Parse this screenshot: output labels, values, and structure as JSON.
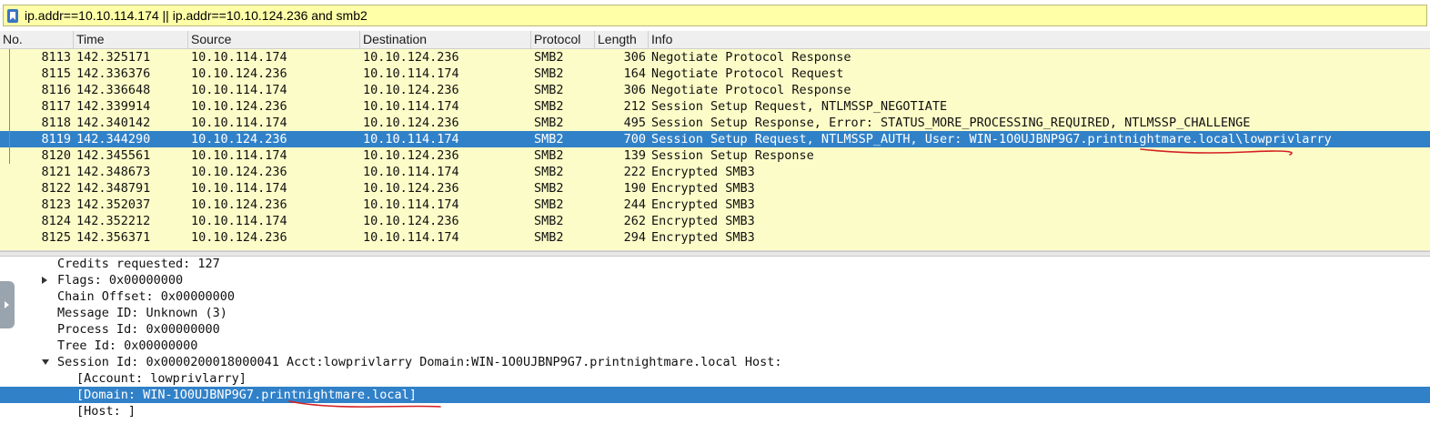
{
  "filter": {
    "value": "ip.addr==10.10.114.174 || ip.addr==10.10.124.236 and smb2",
    "icon": "bookmark-icon"
  },
  "packet_list": {
    "columns": [
      "No.",
      "Time",
      "Source",
      "Destination",
      "Protocol",
      "Length",
      "Info"
    ],
    "rows": [
      {
        "no": "8113",
        "time": "142.325171",
        "src": "10.10.114.174",
        "dst": "10.10.124.236",
        "proto": "SMB2",
        "len": "306",
        "info": "Negotiate Protocol Response"
      },
      {
        "no": "8115",
        "time": "142.336376",
        "src": "10.10.124.236",
        "dst": "10.10.114.174",
        "proto": "SMB2",
        "len": "164",
        "info": "Negotiate Protocol Request"
      },
      {
        "no": "8116",
        "time": "142.336648",
        "src": "10.10.114.174",
        "dst": "10.10.124.236",
        "proto": "SMB2",
        "len": "306",
        "info": "Negotiate Protocol Response"
      },
      {
        "no": "8117",
        "time": "142.339914",
        "src": "10.10.124.236",
        "dst": "10.10.114.174",
        "proto": "SMB2",
        "len": "212",
        "info": "Session Setup Request, NTLMSSP_NEGOTIATE"
      },
      {
        "no": "8118",
        "time": "142.340142",
        "src": "10.10.114.174",
        "dst": "10.10.124.236",
        "proto": "SMB2",
        "len": "495",
        "info": "Session Setup Response, Error: STATUS_MORE_PROCESSING_REQUIRED, NTLMSSP_CHALLENGE"
      },
      {
        "no": "8119",
        "time": "142.344290",
        "src": "10.10.124.236",
        "dst": "10.10.114.174",
        "proto": "SMB2",
        "len": "700",
        "info": "Session Setup Request, NTLMSSP_AUTH, User: WIN-1O0UJBNP9G7.printnightmare.local\\lowprivlarry"
      },
      {
        "no": "8120",
        "time": "142.345561",
        "src": "10.10.114.174",
        "dst": "10.10.124.236",
        "proto": "SMB2",
        "len": "139",
        "info": "Session Setup Response"
      },
      {
        "no": "8121",
        "time": "142.348673",
        "src": "10.10.124.236",
        "dst": "10.10.114.174",
        "proto": "SMB2",
        "len": "222",
        "info": "Encrypted SMB3"
      },
      {
        "no": "8122",
        "time": "142.348791",
        "src": "10.10.114.174",
        "dst": "10.10.124.236",
        "proto": "SMB2",
        "len": "190",
        "info": "Encrypted SMB3"
      },
      {
        "no": "8123",
        "time": "142.352037",
        "src": "10.10.124.236",
        "dst": "10.10.114.174",
        "proto": "SMB2",
        "len": "244",
        "info": "Encrypted SMB3"
      },
      {
        "no": "8124",
        "time": "142.352212",
        "src": "10.10.114.174",
        "dst": "10.10.124.236",
        "proto": "SMB2",
        "len": "262",
        "info": "Encrypted SMB3"
      },
      {
        "no": "8125",
        "time": "142.356371",
        "src": "10.10.124.236",
        "dst": "10.10.114.174",
        "proto": "SMB2",
        "len": "294",
        "info": "Encrypted SMB3"
      }
    ],
    "selected_no": "8119",
    "row_bg": "#fcfcc8",
    "selected_bg": "#3181c8"
  },
  "detail_tree": {
    "lines": [
      {
        "text": "Credits requested: 127"
      },
      {
        "text": "Flags: 0x00000000",
        "toggle": "closed"
      },
      {
        "text": "Chain Offset: 0x00000000"
      },
      {
        "text": "Message ID: Unknown (3)"
      },
      {
        "text": "Process Id: 0x00000000"
      },
      {
        "text": "Tree Id: 0x00000000"
      },
      {
        "text": "Session Id: 0x0000200018000041 Acct:lowprivlarry Domain:WIN-1O0UJBNP9G7.printnightmare.local Host:",
        "toggle": "open"
      },
      {
        "text": "[Account: lowprivlarry]"
      },
      {
        "text": "[Domain: WIN-1O0UJBNP9G7.printnightmare.local]",
        "selected": true
      },
      {
        "text": "[Host: ]"
      }
    ]
  },
  "annotation_color": "#d42020"
}
